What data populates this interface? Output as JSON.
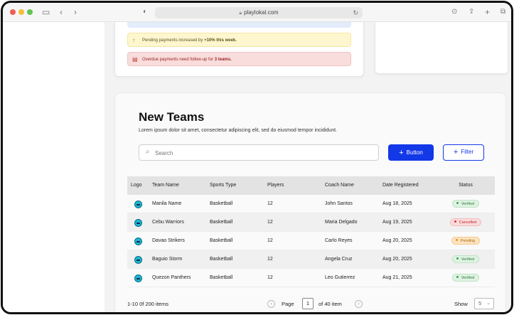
{
  "browser": {
    "url": "playlokal.com",
    "icons": [
      "sidebar-toggle-icon",
      "back-icon",
      "forward-icon",
      "shield-icon",
      "lock-icon",
      "reload-icon",
      "download-icon",
      "share-icon",
      "new-tab-icon",
      "tabs-overview-icon"
    ]
  },
  "alerts": {
    "pending_text": "Pending payments increased by ",
    "pending_bold": "+10% this week.",
    "overdue_text": "Overdue payments need follow-up for ",
    "overdue_bold": "3 teams."
  },
  "main": {
    "title": "New Teams",
    "subtitle": "Lorem ipsum dolor sit amet, consectetur adipiscing elit, sed do eiusmod tempor incididunt.",
    "search_placeholder": "Search",
    "primary_button": "Button",
    "filter_button": "Filter"
  },
  "table": {
    "columns": [
      "Logo",
      "Team Name",
      "Sports Type",
      "Players",
      "Coach Name",
      "Date Registered",
      "Status"
    ],
    "rows": [
      {
        "team": "Manila Name",
        "sport": "Basketball",
        "players": "12",
        "coach": "John Santos",
        "date": "Aug 18, 2025",
        "status": "Verified"
      },
      {
        "team": "Cebu Warriors",
        "sport": "Basketball",
        "players": "12",
        "coach": "Maria Delgado",
        "date": "Aug 19, 2025",
        "status": "Cancelled"
      },
      {
        "team": "Davao Strikers",
        "sport": "Basketball",
        "players": "12",
        "coach": "Carlo Reyes",
        "date": "Aug 20, 2025",
        "status": "Pending"
      },
      {
        "team": "Baguio Storm",
        "sport": "Basketball",
        "players": "12",
        "coach": "Angela Cruz",
        "date": "Aug 20, 2025",
        "status": "Verified"
      },
      {
        "team": "Quezon Panthers",
        "sport": "Basketball",
        "players": "12",
        "coach": "Leo Gutierrez",
        "date": "Aug 21, 2025",
        "status": "Verified"
      }
    ],
    "status_colors": {
      "Verified": "#3aa24f",
      "Cancelled": "#d93636",
      "Pending": "#e6952a"
    }
  },
  "pagination": {
    "items_count": "1-10 0f 200 items",
    "page_label": "Page",
    "current_page": "1",
    "of_label": "of 40 item",
    "show_label": "Show",
    "show_value": "5"
  },
  "colors": {
    "accent": "#1238e8"
  }
}
